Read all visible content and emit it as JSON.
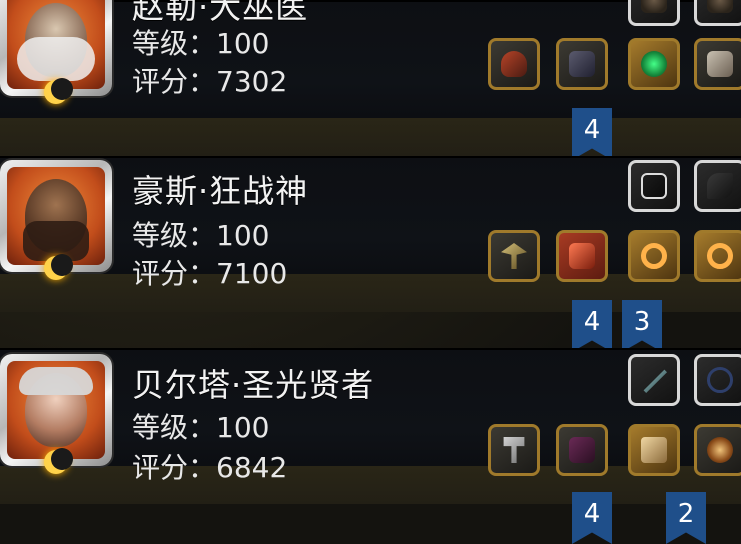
{
  "heroes": [
    {
      "name": "赵勒·大巫医",
      "level_label": "等级：",
      "level": "100",
      "score_label": "评分：",
      "score": "7302",
      "badges": [
        "4"
      ],
      "slots": [
        "staff-icon",
        "shield-icon",
        "emerald-icon",
        "scroll-icon"
      ],
      "top_slots": [
        "boot-icon",
        "boot-icon"
      ]
    },
    {
      "name": "豪斯·狂战神",
      "level_label": "等级：",
      "level": "100",
      "score_label": "评分：",
      "score": "7100",
      "badges": [
        "4",
        "3"
      ],
      "slots": [
        "axe-icon",
        "armor-icon",
        "ring-icon",
        "ring-icon"
      ],
      "top_slots": [
        "rune-icon",
        "feather-icon"
      ]
    },
    {
      "name": "贝尔塔·圣光贤者",
      "level_label": "等级：",
      "level": "100",
      "score_label": "评分：",
      "score": "6842",
      "badges": [
        "4",
        "2"
      ],
      "slots": [
        "hammer-icon",
        "robe-icon",
        "scroll-icon",
        "shield-icon"
      ],
      "top_slots": [
        "dagger-icon",
        "bow-icon"
      ]
    }
  ]
}
